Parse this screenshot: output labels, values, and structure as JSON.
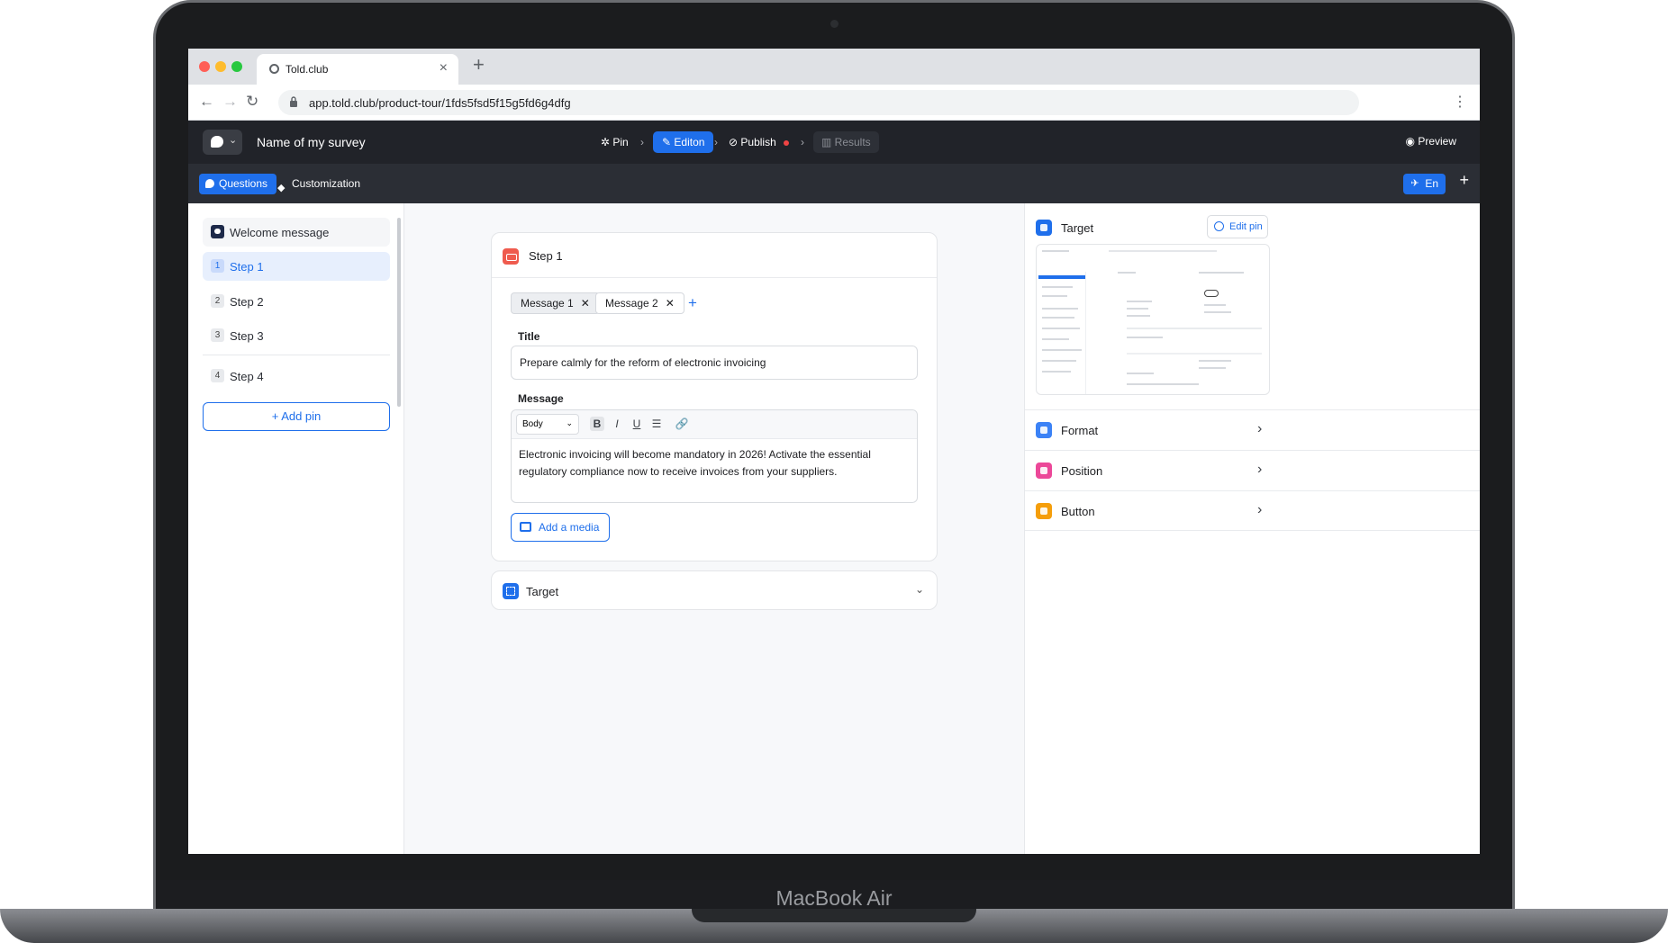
{
  "device": {
    "label": "MacBook Air"
  },
  "browser": {
    "tab_title": "Told.club",
    "url": "app.told.club/product-tour/1fds5fsd5f15g5fd6g4dfg",
    "nav": {
      "back": "←",
      "forward": "→",
      "reload": "↻",
      "new_tab": "+",
      "close_tab": "×",
      "menu": "⋮"
    }
  },
  "header": {
    "survey_name": "Name of my survey",
    "steps": [
      {
        "label": "Pin",
        "icon": "pin-icon",
        "state": "done"
      },
      {
        "label": "Editon",
        "icon": "pencil-icon",
        "state": "active"
      },
      {
        "label": "Publish",
        "icon": "eye-off-icon",
        "state": "pending"
      },
      {
        "label": "Results",
        "icon": "bar-chart-icon",
        "state": "disabled"
      }
    ],
    "separator": "›",
    "preview_label": "Preview"
  },
  "toolbar": {
    "questions_label": "Questions",
    "customization_label": "Customization",
    "language_label": "En",
    "add_label": "+"
  },
  "sidebar": {
    "welcome_label": "Welcome message",
    "steps": [
      {
        "num": "1",
        "label": "Step 1",
        "active": true
      },
      {
        "num": "2",
        "label": "Step 2",
        "active": false
      },
      {
        "num": "3",
        "label": "Step 3",
        "active": false
      },
      {
        "num": "4",
        "label": "Step 4",
        "active": false
      }
    ],
    "add_pin_label": "+ Add pin"
  },
  "main": {
    "step_title": "Step 1",
    "messages": [
      {
        "label": "Message 1",
        "selected": true
      },
      {
        "label": "Message 2",
        "selected": false
      }
    ],
    "add_message": "+",
    "title_label": "Title",
    "title_value": "Prepare calmly for the reform of electronic invoicing",
    "message_label": "Message",
    "text_style": "Body",
    "format_buttons": [
      "B",
      "I",
      "U",
      "☰",
      "🔗"
    ],
    "message_body": "Electronic invoicing will become mandatory in 2026! Activate the essential regulatory compliance now to receive invoices from your suppliers.",
    "add_media_label": "Add a media",
    "target_section_label": "Target"
  },
  "right_panel": {
    "target_label": "Target",
    "edit_pin_label": "Edit pin",
    "sections": [
      {
        "label": "Format",
        "icon": "layout-icon",
        "color": "#3b82f6"
      },
      {
        "label": "Position",
        "icon": "move-icon",
        "color": "#ec4899"
      },
      {
        "label": "Button",
        "icon": "cursor-icon",
        "color": "#f59e0b"
      }
    ]
  },
  "colors": {
    "accent": "#1f6feb",
    "dark_bar": "#212329",
    "step_icon": "#ef5b4e"
  }
}
